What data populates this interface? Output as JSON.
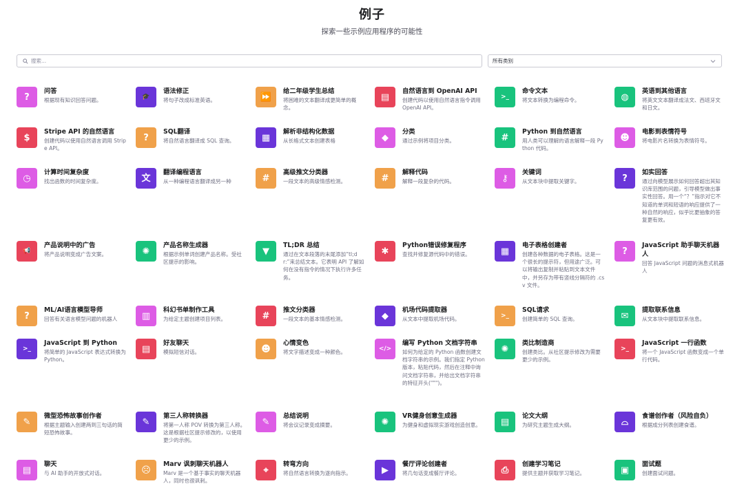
{
  "page": {
    "title": "例子",
    "subtitle": "探索一些示例应用程序的可能性"
  },
  "search": {
    "placeholder": "搜索...",
    "icon": "search-icon"
  },
  "category_select": {
    "selected": "所有类别",
    "icon": "chevron-down-icon"
  },
  "colors": {
    "pink": "#dd5ce5",
    "purple": "#6a35d9",
    "orange": "#f0a14a",
    "red": "#e8445a",
    "green": "#19c37d",
    "blue": "#5436da"
  },
  "examples": [
    {
      "name": "问答",
      "desc": "根据现有知识回答问题。",
      "color": "#dd5ce5",
      "icon": "question-icon",
      "glyph": "?"
    },
    {
      "name": "语法修正",
      "desc": "将句子改成标准英语。",
      "color": "#6a35d9",
      "icon": "graduation-cap-icon",
      "glyph": "🎓"
    },
    {
      "name": "给二年级学生总结",
      "desc": "将困难的文本翻译成更简单的概念。",
      "color": "#f0a14a",
      "icon": "fast-forward-icon",
      "glyph": "⏩"
    },
    {
      "name": "自然语言到 OpenAI API",
      "desc": "创建代码以使用自然语言指令调用 OpenAI API。",
      "color": "#e8445a",
      "icon": "chat-icon",
      "glyph": "▤"
    },
    {
      "name": "命令文本",
      "desc": "将文本转换为编程命令。",
      "color": "#19c37d",
      "icon": "terminal-icon",
      "glyph": ">_"
    },
    {
      "name": "英语到其他语言",
      "desc": "将英文文本翻译成法文、西班牙文和日文。",
      "color": "#19c37d",
      "icon": "globe-icon",
      "glyph": "◍"
    },
    {
      "name": "Stripe API 的自然语言",
      "desc": "创建代码以使用自然语言调用 Stripe API。",
      "color": "#e8445a",
      "icon": "dollar-icon",
      "glyph": "$"
    },
    {
      "name": "SQL翻译",
      "desc": "将自然语言翻译成 SQL 查询。",
      "color": "#f0a14a",
      "icon": "question-icon",
      "glyph": "?"
    },
    {
      "name": "解析非结构化数据",
      "desc": "从长格式文本创建表格",
      "color": "#6a35d9",
      "icon": "table-icon",
      "glyph": "▦"
    },
    {
      "name": "分类",
      "desc": "通过示例将项目分类。",
      "color": "#dd5ce5",
      "icon": "tag-icon",
      "glyph": "◆"
    },
    {
      "name": "Python 到自然语言",
      "desc": "用人类可以理解的语言解释一段 Python 代码。",
      "color": "#19c37d",
      "icon": "hashtag-icon",
      "glyph": "#"
    },
    {
      "name": "电影到表情符号",
      "desc": "将电影片名转换为表情符号。",
      "color": "#dd5ce5",
      "icon": "smile-icon",
      "glyph": "☻"
    },
    {
      "name": "计算时间复杂度",
      "desc": "找出函数的时间复杂度。",
      "color": "#dd5ce5",
      "icon": "clock-icon",
      "glyph": "◷"
    },
    {
      "name": "翻译编程语言",
      "desc": "从一种编程语言翻译成另一种",
      "color": "#6a35d9",
      "icon": "translate-icon",
      "glyph": "文"
    },
    {
      "name": "高级推文分类器",
      "desc": "一段文本的高级情感检测。",
      "color": "#f0a14a",
      "icon": "hashtag-icon",
      "glyph": "#"
    },
    {
      "name": "解释代码",
      "desc": "解释一段复杂的代码。",
      "color": "#f0a14a",
      "icon": "hashtag-icon",
      "glyph": "#"
    },
    {
      "name": "关键词",
      "desc": "从文本块中提取关键字。",
      "color": "#dd5ce5",
      "icon": "key-icon",
      "glyph": "⚷"
    },
    {
      "name": "如实回答",
      "desc": "通过向模型展示如何回答超出其知识库范围的问题，引导模型做出事实性回答。用一个“？”指示对它不知道的单词和短语的响应提供了一种自然的响应，似乎比更抽象的答复更有效。",
      "color": "#6a35d9",
      "icon": "question-icon",
      "glyph": "?"
    },
    {
      "name": "产品说明中的广告",
      "desc": "将产品说明变成广告文案。",
      "color": "#e8445a",
      "icon": "megaphone-icon",
      "glyph": "📢"
    },
    {
      "name": "产品名称生成器",
      "desc": "根据示例单词创建产品名称。受社区提示的影响。",
      "color": "#19c37d",
      "icon": "lightbulb-icon",
      "glyph": "✺"
    },
    {
      "name": "TL;DR 总结",
      "desc": "通过在文本段落的末尾添加“tl;dr:”来总结文本。它表明 API 了解如何在没有指令的情况下执行许多任务。",
      "color": "#19c37d",
      "icon": "filter-icon",
      "glyph": "▼"
    },
    {
      "name": "Python错误修复程序",
      "desc": "查找并修复源代码中的错误。",
      "color": "#e8445a",
      "icon": "bug-icon",
      "glyph": "✱"
    },
    {
      "name": "电子表格创建者",
      "desc": "创建各种数据的电子表格。这是一个很长的提示符，但用途广泛。可以将输出复制并粘贴到文本文件中，并另存为带有竖线分隔符的 .csv 文件。",
      "color": "#6a35d9",
      "icon": "table-icon",
      "glyph": "▦"
    },
    {
      "name": "JavaScript 助手聊天机器人",
      "desc": "回答 JavaScript 问题的消息式机器人",
      "color": "#dd5ce5",
      "icon": "question-icon",
      "glyph": "?"
    },
    {
      "name": "ML/AI语言模型导师",
      "desc": "回答有关语言模型问题的机器人",
      "color": "#f0a14a",
      "icon": "question-icon",
      "glyph": "?"
    },
    {
      "name": "科幻书单制作工具",
      "desc": "为给定主题创建项目列表。",
      "color": "#dd5ce5",
      "icon": "book-icon",
      "glyph": "▥"
    },
    {
      "name": "推文分类器",
      "desc": "一段文本的基本情感检测。",
      "color": "#e8445a",
      "icon": "hashtag-icon",
      "glyph": "#"
    },
    {
      "name": "机场代码提取器",
      "desc": "从文本中提取机场代码。",
      "color": "#6a35d9",
      "icon": "tag-icon",
      "glyph": "◆"
    },
    {
      "name": "SQL请求",
      "desc": "创建简单的 SQL 查询。",
      "color": "#f0a14a",
      "icon": "terminal-icon",
      "glyph": ">_"
    },
    {
      "name": "提取联系信息",
      "desc": "从文本块中提取联系信息。",
      "color": "#19c37d",
      "icon": "mail-icon",
      "glyph": "✉"
    },
    {
      "name": "JavaScript 到 Python",
      "desc": "将简单的 JavaScript 表达式转换为 Python。",
      "color": "#6a35d9",
      "icon": "terminal-icon",
      "glyph": ">_"
    },
    {
      "name": "好友聊天",
      "desc": "模拟短信对话。",
      "color": "#e8445a",
      "icon": "chat-icon",
      "glyph": "▤"
    },
    {
      "name": "心情变色",
      "desc": "将文字描述变成一种颜色。",
      "color": "#f0a14a",
      "icon": "smile-icon",
      "glyph": "☻"
    },
    {
      "name": "编写 Python 文档字符串",
      "desc": "如何为给定的 Python 函数创建文档字符串的示例。我们指定 Python 版本，粘贴代码，然后在注释中询问文档字符串，并给出文档字符串的特征开头(\"\"\")。",
      "color": "#dd5ce5",
      "icon": "code-icon",
      "glyph": "</>"
    },
    {
      "name": "类比制造商",
      "desc": "创建类比。从社区提示修改为需要更少的示例。",
      "color": "#19c37d",
      "icon": "lightbulb-icon",
      "glyph": "✺"
    },
    {
      "name": "JavaScript 一行函数",
      "desc": "将一个 JavaScript 函数变成一个单行代码。",
      "color": "#e8445a",
      "icon": "terminal-icon",
      "glyph": ">_"
    },
    {
      "name": "微型恐怖故事创作者",
      "desc": "根据主题输入创建两到三句话的简短恐怖故事。",
      "color": "#f0a14a",
      "icon": "edit-icon",
      "glyph": "✎"
    },
    {
      "name": "第三人称转换器",
      "desc": "将第一人称 POV 转换为第三人称。这是根据社区提示修改的，以使用更少的示例。",
      "color": "#6a35d9",
      "icon": "edit-icon",
      "glyph": "✎"
    },
    {
      "name": "总结说明",
      "desc": "将会议记录变成摘要。",
      "color": "#dd5ce5",
      "icon": "edit-icon",
      "glyph": "✎"
    },
    {
      "name": "VR健身创意生成器",
      "desc": "为健身和虚拟现实游戏创造创意。",
      "color": "#19c37d",
      "icon": "lightbulb-icon",
      "glyph": "✺"
    },
    {
      "name": "论文大纲",
      "desc": "为研究主题生成大纲。",
      "color": "#19c37d",
      "icon": "document-icon",
      "glyph": "▤"
    },
    {
      "name": "食谱创作者（风险自负）",
      "desc": "根据成分列表创建食谱。",
      "color": "#6a35d9",
      "icon": "dish-icon",
      "glyph": "⌓"
    },
    {
      "name": "聊天",
      "desc": "与 AI 助手的开放式对话。",
      "color": "#dd5ce5",
      "icon": "chat-icon",
      "glyph": "▤"
    },
    {
      "name": "Marv 讽刺聊天机器人",
      "desc": "Marv 是一个基于事实的聊天机器人，同时也很讽刺。",
      "color": "#f0a14a",
      "icon": "sad-face-icon",
      "glyph": "☹"
    },
    {
      "name": "转弯方向",
      "desc": "将自然语言转换为逐向指示。",
      "color": "#e8445a",
      "icon": "location-pin-icon",
      "glyph": "⌖"
    },
    {
      "name": "餐厅评论创建者",
      "desc": "将几句话变成餐厅评论。",
      "color": "#6a35d9",
      "icon": "video-icon",
      "glyph": "▶"
    },
    {
      "name": "创建学习笔记",
      "desc": "提供主题并获取学习笔记。",
      "color": "#e8445a",
      "icon": "printer-icon",
      "glyph": "⎙"
    },
    {
      "name": "面试题",
      "desc": "创建面试问题。",
      "color": "#19c37d",
      "icon": "briefcase-icon",
      "glyph": "▣"
    }
  ]
}
